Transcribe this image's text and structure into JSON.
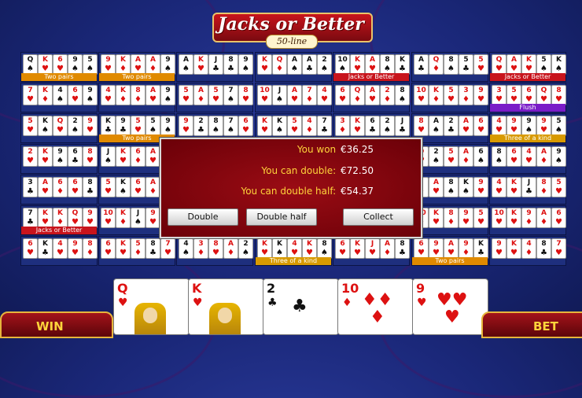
{
  "game": {
    "title": "Jacks or Better",
    "subtitle": "50-line"
  },
  "colors": {
    "label_two_pairs": "#e08a00",
    "label_jacks": "#c8141c",
    "label_flush": "#7a1cc8",
    "label_three": "#d89a00"
  },
  "hands": [
    {
      "cards": [
        [
          "Q",
          "♠"
        ],
        [
          "K",
          "♥"
        ],
        [
          "6",
          "♥"
        ],
        [
          "9",
          "♠"
        ],
        [
          "5",
          "♠"
        ]
      ],
      "label": "Two pairs",
      "label_color": "#e08a00"
    },
    {
      "cards": [
        [
          "9",
          "♥"
        ],
        [
          "K",
          "♦"
        ],
        [
          "A",
          "♥"
        ],
        [
          "A",
          "♦"
        ],
        [
          "9",
          "♠"
        ]
      ],
      "label": "Two pairs",
      "label_color": "#e08a00"
    },
    {
      "cards": [
        [
          "A",
          "♠"
        ],
        [
          "K",
          "♥"
        ],
        [
          "J",
          "♣"
        ],
        [
          "8",
          "♣"
        ],
        [
          "9",
          "♠"
        ]
      ],
      "label": "",
      "label_color": ""
    },
    {
      "cards": [
        [
          "K",
          "♥"
        ],
        [
          "Q",
          "♦"
        ],
        [
          "A",
          "♠"
        ],
        [
          "A",
          "♣"
        ],
        [
          "2",
          "♠"
        ]
      ],
      "label": "",
      "label_color": ""
    },
    {
      "cards": [
        [
          "10",
          "♠"
        ],
        [
          "K",
          "♥"
        ],
        [
          "A",
          "♥"
        ],
        [
          "8",
          "♠"
        ],
        [
          "K",
          "♣"
        ]
      ],
      "label": "Jacks or Better",
      "label_color": "#c8141c"
    },
    {
      "cards": [
        [
          "A",
          "♣"
        ],
        [
          "Q",
          "♦"
        ],
        [
          "8",
          "♠"
        ],
        [
          "5",
          "♣"
        ],
        [
          "5",
          "♥"
        ]
      ],
      "label": "",
      "label_color": ""
    },
    {
      "cards": [
        [
          "Q",
          "♥"
        ],
        [
          "A",
          "♥"
        ],
        [
          "K",
          "♥"
        ],
        [
          "5",
          "♠"
        ],
        [
          "K",
          "♠"
        ]
      ],
      "label": "Jacks or Better",
      "label_color": "#c8141c"
    },
    {
      "cards": [
        [
          "7",
          "♥"
        ],
        [
          "K",
          "♦"
        ],
        [
          "4",
          "♠"
        ],
        [
          "6",
          "♥"
        ],
        [
          "9",
          "♠"
        ]
      ],
      "label": "",
      "label_color": ""
    },
    {
      "cards": [
        [
          "4",
          "♥"
        ],
        [
          "K",
          "♦"
        ],
        [
          "8",
          "♦"
        ],
        [
          "A",
          "♥"
        ],
        [
          "9",
          "♠"
        ]
      ],
      "label": "",
      "label_color": ""
    },
    {
      "cards": [
        [
          "5",
          "♥"
        ],
        [
          "A",
          "♦"
        ],
        [
          "5",
          "♥"
        ],
        [
          "7",
          "♠"
        ],
        [
          "8",
          "♥"
        ]
      ],
      "label": "",
      "label_color": ""
    },
    {
      "cards": [
        [
          "10",
          "♥"
        ],
        [
          "J",
          "♠"
        ],
        [
          "A",
          "♥"
        ],
        [
          "7",
          "♦"
        ],
        [
          "4",
          "♥"
        ]
      ],
      "label": "",
      "label_color": ""
    },
    {
      "cards": [
        [
          "6",
          "♥"
        ],
        [
          "Q",
          "♦"
        ],
        [
          "A",
          "♥"
        ],
        [
          "2",
          "♦"
        ],
        [
          "8",
          "♠"
        ]
      ],
      "label": "",
      "label_color": ""
    },
    {
      "cards": [
        [
          "10",
          "♥"
        ],
        [
          "K",
          "♦"
        ],
        [
          "5",
          "♥"
        ],
        [
          "3",
          "♦"
        ],
        [
          "9",
          "♥"
        ]
      ],
      "label": "",
      "label_color": ""
    },
    {
      "cards": [
        [
          "3",
          "♥"
        ],
        [
          "5",
          "♥"
        ],
        [
          "6",
          "♥"
        ],
        [
          "Q",
          "♥"
        ],
        [
          "8",
          "♥"
        ]
      ],
      "label": "Flush",
      "label_color": "#7a1cc8"
    },
    {
      "cards": [
        [
          "5",
          "♥"
        ],
        [
          "K",
          "♠"
        ],
        [
          "Q",
          "♥"
        ],
        [
          "2",
          "♠"
        ],
        [
          "9",
          "♥"
        ]
      ],
      "label": "",
      "label_color": ""
    },
    {
      "cards": [
        [
          "K",
          "♣"
        ],
        [
          "9",
          "♣"
        ],
        [
          "5",
          "♥"
        ],
        [
          "5",
          "♠"
        ],
        [
          "9",
          "♠"
        ]
      ],
      "label": "Two pairs",
      "label_color": "#e08a00"
    },
    {
      "cards": [
        [
          "9",
          "♥"
        ],
        [
          "2",
          "♣"
        ],
        [
          "8",
          "♠"
        ],
        [
          "7",
          "♠"
        ],
        [
          "6",
          "♥"
        ]
      ],
      "label": "",
      "label_color": ""
    },
    {
      "cards": [
        [
          "K",
          "♥"
        ],
        [
          "K",
          "♠"
        ],
        [
          "5",
          "♥"
        ],
        [
          "4",
          "♦"
        ],
        [
          "7",
          "♣"
        ]
      ],
      "label": "",
      "label_color": ""
    },
    {
      "cards": [
        [
          "3",
          "♦"
        ],
        [
          "K",
          "♥"
        ],
        [
          "6",
          "♣"
        ],
        [
          "2",
          "♠"
        ],
        [
          "J",
          "♣"
        ]
      ],
      "label": "",
      "label_color": ""
    },
    {
      "cards": [
        [
          "8",
          "♥"
        ],
        [
          "A",
          "♠"
        ],
        [
          "2",
          "♣"
        ],
        [
          "A",
          "♥"
        ],
        [
          "6",
          "♥"
        ]
      ],
      "label": "",
      "label_color": ""
    },
    {
      "cards": [
        [
          "4",
          "♥"
        ],
        [
          "9",
          "♥"
        ],
        [
          "9",
          "♠"
        ],
        [
          "9",
          "♥"
        ],
        [
          "5",
          "♠"
        ]
      ],
      "label": "Three of a kind",
      "label_color": "#d89a00"
    },
    {
      "cards": [
        [
          "2",
          "♥"
        ],
        [
          "K",
          "♥"
        ],
        [
          "9",
          "♠"
        ],
        [
          "6",
          "♣"
        ],
        [
          "8",
          "♥"
        ]
      ],
      "label": "",
      "label_color": ""
    },
    {
      "cards": [
        [
          "J",
          "♠"
        ],
        [
          "K",
          "♥"
        ],
        [
          "6",
          "♦"
        ],
        [
          "A",
          "♥"
        ],
        [
          "7",
          "♥"
        ]
      ],
      "label": "",
      "label_color": ""
    },
    {
      "cards": [],
      "label": "",
      "label_color": ""
    },
    {
      "cards": [],
      "label": "",
      "label_color": ""
    },
    {
      "cards": [],
      "label": "",
      "label_color": ""
    },
    {
      "cards": [
        [
          "Q",
          "♥"
        ],
        [
          "2",
          "♠"
        ],
        [
          "5",
          "♥"
        ],
        [
          "A",
          "♦"
        ],
        [
          "6",
          "♠"
        ]
      ],
      "label": "",
      "label_color": ""
    },
    {
      "cards": [
        [
          "8",
          "♠"
        ],
        [
          "6",
          "♥"
        ],
        [
          "4",
          "♥"
        ],
        [
          "A",
          "♦"
        ],
        [
          "9",
          "♠"
        ]
      ],
      "label": "",
      "label_color": ""
    },
    {
      "cards": [
        [
          "3",
          "♣"
        ],
        [
          "A",
          "♥"
        ],
        [
          "6",
          "♦"
        ],
        [
          "6",
          "♥"
        ],
        [
          "8",
          "♣"
        ]
      ],
      "label": "",
      "label_color": ""
    },
    {
      "cards": [
        [
          "5",
          "♥"
        ],
        [
          "K",
          "♠"
        ],
        [
          "6",
          "♥"
        ],
        [
          "A",
          "♦"
        ],
        [
          "7",
          "♥"
        ]
      ],
      "label": "",
      "label_color": ""
    },
    {
      "cards": [],
      "label": "",
      "label_color": ""
    },
    {
      "cards": [],
      "label": "",
      "label_color": ""
    },
    {
      "cards": [],
      "label": "",
      "label_color": ""
    },
    {
      "cards": [
        [
          "3",
          "♦"
        ],
        [
          "A",
          "♥"
        ],
        [
          "8",
          "♠"
        ],
        [
          "K",
          "♠"
        ],
        [
          "9",
          "♥"
        ]
      ],
      "label": "",
      "label_color": ""
    },
    {
      "cards": [
        [
          "4",
          "♥"
        ],
        [
          "K",
          "♥"
        ],
        [
          "J",
          "♣"
        ],
        [
          "8",
          "♦"
        ],
        [
          "5",
          "♥"
        ]
      ],
      "label": "",
      "label_color": ""
    },
    {
      "cards": [
        [
          "7",
          "♣"
        ],
        [
          "K",
          "♥"
        ],
        [
          "K",
          "♦"
        ],
        [
          "Q",
          "♥"
        ],
        [
          "9",
          "♥"
        ]
      ],
      "label": "Jacks or Better",
      "label_color": "#c8141c"
    },
    {
      "cards": [
        [
          "10",
          "♥"
        ],
        [
          "K",
          "♦"
        ],
        [
          "J",
          "♠"
        ],
        [
          "9",
          "♥"
        ],
        [
          "7",
          "♠"
        ]
      ],
      "label": "",
      "label_color": ""
    },
    {
      "cards": [],
      "label": "",
      "label_color": ""
    },
    {
      "cards": [],
      "label": "",
      "label_color": ""
    },
    {
      "cards": [],
      "label": "",
      "label_color": ""
    },
    {
      "cards": [
        [
          "10",
          "♦"
        ],
        [
          "K",
          "♥"
        ],
        [
          "8",
          "♦"
        ],
        [
          "9",
          "♥"
        ],
        [
          "5",
          "♥"
        ]
      ],
      "label": "",
      "label_color": ""
    },
    {
      "cards": [
        [
          "10",
          "♥"
        ],
        [
          "K",
          "♥"
        ],
        [
          "9",
          "♦"
        ],
        [
          "A",
          "♦"
        ],
        [
          "6",
          "♥"
        ]
      ],
      "label": "",
      "label_color": ""
    },
    {
      "cards": [
        [
          "6",
          "♥"
        ],
        [
          "K",
          "♣"
        ],
        [
          "4",
          "♥"
        ],
        [
          "9",
          "♥"
        ],
        [
          "8",
          "♦"
        ]
      ],
      "label": "",
      "label_color": ""
    },
    {
      "cards": [
        [
          "6",
          "♥"
        ],
        [
          "K",
          "♥"
        ],
        [
          "5",
          "♦"
        ],
        [
          "8",
          "♣"
        ],
        [
          "7",
          "♥"
        ]
      ],
      "label": "",
      "label_color": ""
    },
    {
      "cards": [
        [
          "4",
          "♠"
        ],
        [
          "3",
          "♦"
        ],
        [
          "8",
          "♥"
        ],
        [
          "A",
          "♦"
        ],
        [
          "2",
          "♠"
        ]
      ],
      "label": "",
      "label_color": ""
    },
    {
      "cards": [
        [
          "K",
          "♥"
        ],
        [
          "K",
          "♠"
        ],
        [
          "4",
          "♥"
        ],
        [
          "K",
          "♥"
        ],
        [
          "8",
          "♠"
        ]
      ],
      "label": "Three of a kind",
      "label_color": "#d89a00"
    },
    {
      "cards": [
        [
          "6",
          "♥"
        ],
        [
          "K",
          "♥"
        ],
        [
          "J",
          "♥"
        ],
        [
          "A",
          "♦"
        ],
        [
          "8",
          "♣"
        ]
      ],
      "label": "",
      "label_color": ""
    },
    {
      "cards": [
        [
          "6",
          "♥"
        ],
        [
          "9",
          "♥"
        ],
        [
          "A",
          "♥"
        ],
        [
          "9",
          "♦"
        ],
        [
          "K",
          "♣"
        ]
      ],
      "label": "Two pairs",
      "label_color": "#e08a00"
    },
    {
      "cards": [
        [
          "9",
          "♥"
        ],
        [
          "K",
          "♥"
        ],
        [
          "4",
          "♦"
        ],
        [
          "8",
          "♣"
        ],
        [
          "7",
          "♥"
        ]
      ],
      "label": "",
      "label_color": ""
    }
  ],
  "dialog": {
    "won_label": "You won",
    "won_value": "€36.25",
    "double_label": "You can double:",
    "double_value": "€72.50",
    "half_label": "You can double half:",
    "half_value": "€54.37",
    "buttons": {
      "double": "Double",
      "double_half": "Double half",
      "collect": "Collect"
    }
  },
  "main_hand": [
    [
      "Q",
      "♥"
    ],
    [
      "K",
      "♥"
    ],
    [
      "2",
      "♣"
    ],
    [
      "10",
      "♦"
    ],
    [
      "9",
      "♥"
    ]
  ],
  "win_label": "WIN",
  "bet_label": "BET"
}
